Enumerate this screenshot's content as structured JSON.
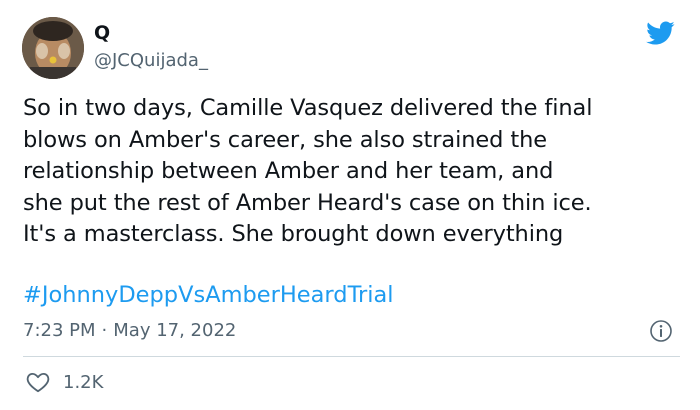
{
  "author": {
    "display_name": "Q",
    "handle": "@JCQuijada_"
  },
  "tweet": {
    "lines": [
      "So in two days, Camille Vasquez delivered the final",
      "blows on Amber's career, she also strained the",
      "relationship between Amber and her team, and",
      "she put the rest of Amber Heard's case on thin ice.",
      "It's a masterclass. She brought down everything"
    ],
    "hashtag": "#JohnnyDeppVsAmberHeardTrial",
    "time": "7:23 PM",
    "separator": "·",
    "date": "May 17, 2022",
    "likes": "1.2K"
  },
  "colors": {
    "brand": "#1d9bf0",
    "text": "#0f1419",
    "muted": "#536471",
    "divider": "#cfd9de"
  },
  "icons": {
    "logo": "twitter-bird-icon",
    "info": "info-icon",
    "like": "heart-icon"
  }
}
